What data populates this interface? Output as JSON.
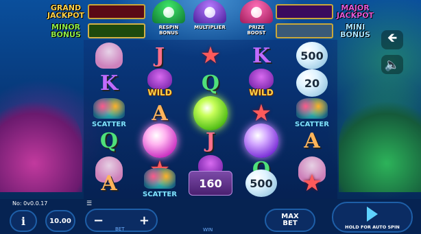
{
  "jackpots": {
    "grand": {
      "line1": "GRAND",
      "line2": "JACKPOT"
    },
    "minor": {
      "line1": "MINOR",
      "line2": "BONUS"
    },
    "major": {
      "line1": "MAJOR",
      "line2": "JACKPOT"
    },
    "mini": {
      "line1": "MINI",
      "line2": "BONUS"
    }
  },
  "bonus_shells": {
    "respin": {
      "line1": "RESPIN",
      "line2": "BONUS"
    },
    "multiplier": {
      "line1": "MULTIPLIER"
    },
    "prize_boost": {
      "line1": "PRIZE",
      "line2": "BOOST"
    }
  },
  "reels": [
    [
      {
        "type": "jellyfish"
      },
      {
        "type": "letter",
        "text": "K",
        "cls": "sym-K"
      },
      {
        "type": "scatter",
        "text": "SCATTER"
      },
      {
        "type": "letter",
        "text": "Q",
        "cls": "sym-Q"
      },
      {
        "type": "jellyfish"
      }
    ],
    [
      {
        "type": "letter",
        "text": "J",
        "cls": "sym-J"
      },
      {
        "type": "wild",
        "text": "WILD"
      },
      {
        "type": "letter",
        "text": "A",
        "cls": "sym-A"
      },
      {
        "type": "orb",
        "color": "pink"
      },
      {
        "type": "starfish"
      }
    ],
    [
      {
        "type": "starfish"
      },
      {
        "type": "letter",
        "text": "Q",
        "cls": "sym-Q"
      },
      {
        "type": "orb",
        "color": "green"
      },
      {
        "type": "letter",
        "text": "J",
        "cls": "sym-J"
      },
      {
        "type": "wild",
        "text": "WILD"
      }
    ],
    [
      {
        "type": "letter",
        "text": "K",
        "cls": "sym-K"
      },
      {
        "type": "wild",
        "text": "WILD"
      },
      {
        "type": "starfish"
      },
      {
        "type": "orb",
        "color": "purple"
      },
      {
        "type": "letter",
        "text": "Q",
        "cls": "sym-Q"
      }
    ],
    [
      {
        "type": "bubble",
        "text": "500"
      },
      {
        "type": "bubble",
        "text": "20"
      },
      {
        "type": "scatter",
        "text": "SCATTER"
      },
      {
        "type": "letter",
        "text": "A",
        "cls": "sym-A"
      },
      {
        "type": "jellyfish"
      }
    ]
  ],
  "row6": {
    "reel1": {
      "type": "letter",
      "text": "A"
    },
    "reel2": {
      "type": "scatter",
      "text": "SCATTER"
    },
    "reel3": {
      "type": "value",
      "text": "160"
    },
    "reel4": {
      "type": "bubble",
      "text": "500"
    },
    "reel5": {
      "type": "starfish"
    }
  },
  "side_buttons": {
    "back_icon": "arrow-left-icon",
    "sound_icon": "speaker-mute-icon"
  },
  "bottom_bar": {
    "version": "No: 0v0.0.17",
    "info_label": "i",
    "balance": "10.00",
    "bet_minus": "−",
    "bet_plus": "+",
    "bet_label": "BET",
    "win_label": "WIN",
    "max_bet_line1": "MAX",
    "max_bet_line2": "BET",
    "spin_hint": "HOLD FOR AUTO SPIN"
  },
  "colors": {
    "background": "#062a5a",
    "grand": "#ffd24a",
    "minor": "#8eea48",
    "major": "#e35bd8",
    "mini": "#a8e3ff",
    "accent": "#5fd3ff"
  }
}
